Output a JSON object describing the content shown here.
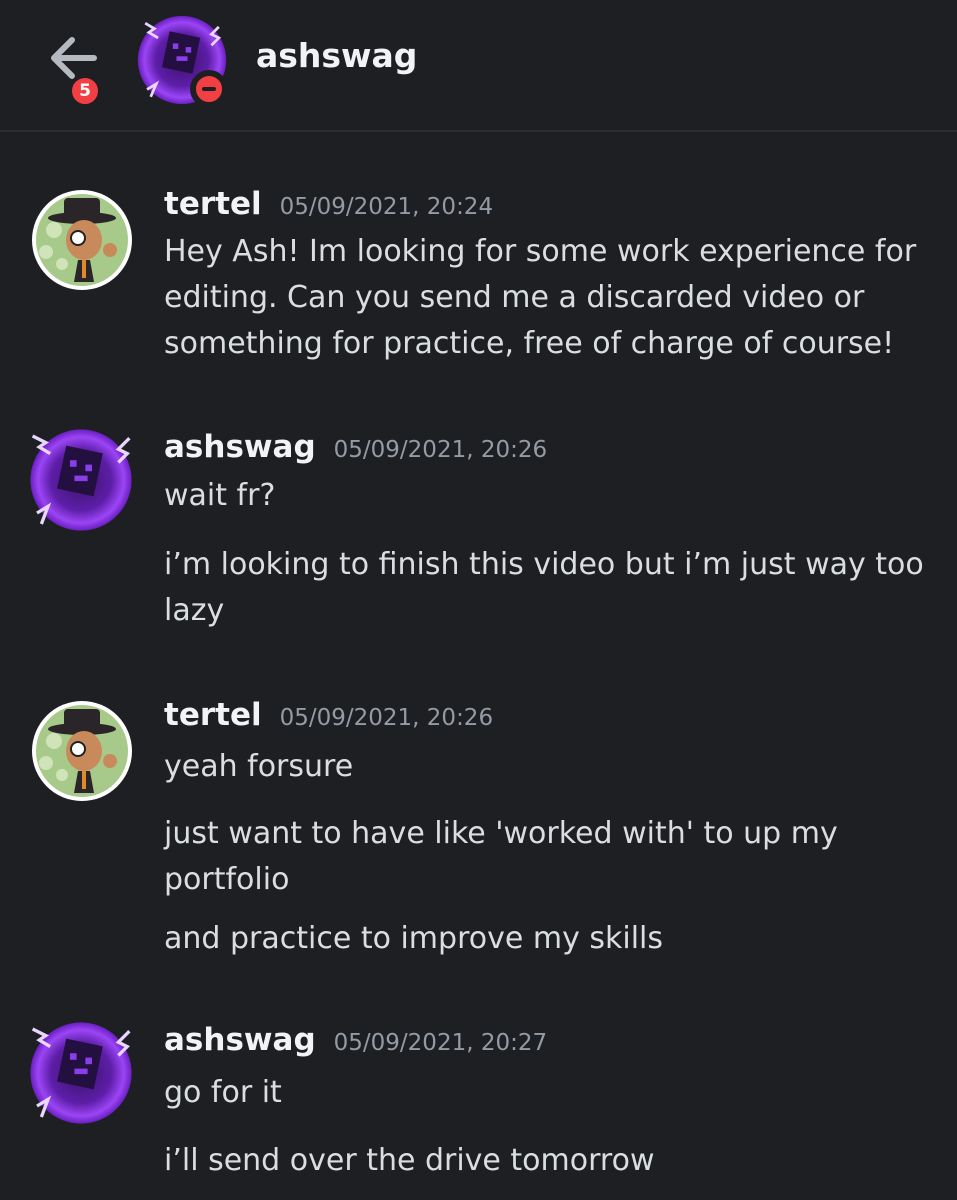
{
  "header": {
    "title": "ashswag",
    "unread_count": "5",
    "back_icon": "arrow-left-icon",
    "status": "do-not-disturb"
  },
  "colors": {
    "background": "#1e1f22",
    "text": "#dbdee1",
    "author": "#f2f3f5",
    "timestamp": "#949ba4",
    "badge": "#f23f43",
    "ashswag_avatar": "#7b2fd6",
    "tertel_avatar": "#a7c98a"
  },
  "messages": [
    {
      "author": "tertel",
      "timestamp": "05/09/2021, 20:24",
      "lines": [
        "Hey Ash! Im looking for some work experience for",
        "editing. Can you send me a discarded video or",
        "something for practice, free of charge of course!"
      ]
    },
    {
      "author": "ashswag",
      "timestamp": "05/09/2021, 20:26",
      "lines": [
        "wait fr?",
        "i’m looking to finish this video but i’m just way too",
        "lazy"
      ]
    },
    {
      "author": "tertel",
      "timestamp": "05/09/2021, 20:26",
      "lines": [
        "yeah forsure",
        "just want to have like 'worked with' to up my",
        "portfolio",
        "and practice to improve my skills"
      ]
    },
    {
      "author": "ashswag",
      "timestamp": "05/09/2021, 20:27",
      "lines": [
        "go for it",
        "i’ll send over the drive tomorrow"
      ]
    }
  ]
}
